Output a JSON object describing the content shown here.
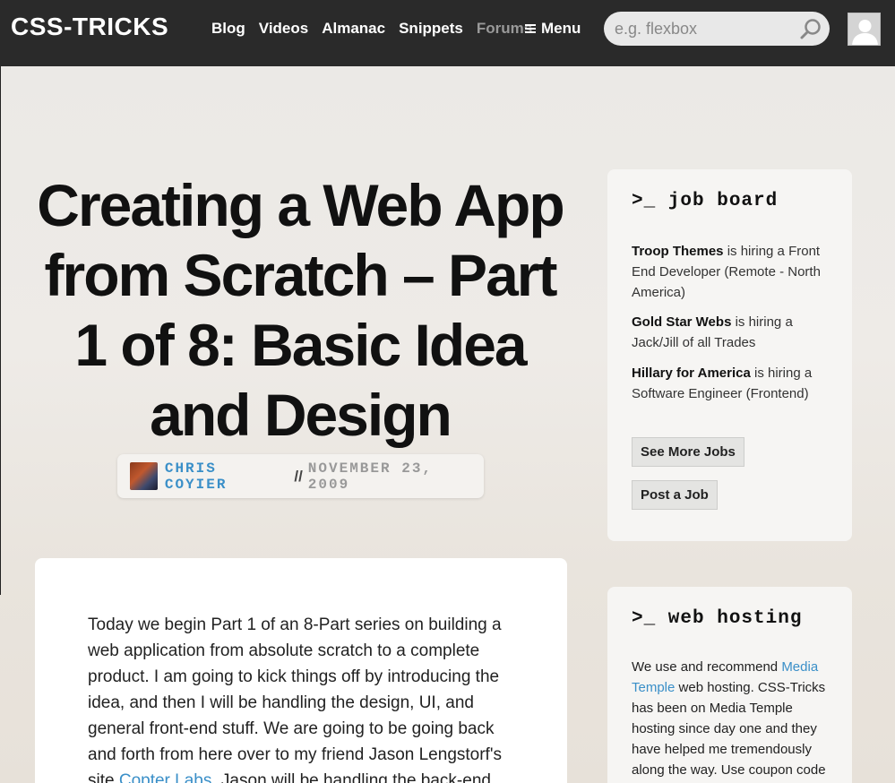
{
  "header": {
    "logo": "CSS-TRICKS",
    "nav": [
      "Blog",
      "Videos",
      "Almanac",
      "Snippets",
      "Forums"
    ],
    "menu_label": "Menu",
    "search_placeholder": "e.g. flexbox"
  },
  "post": {
    "title": "Creating a Web App from Scratch – Part 1 of 8: Basic Idea and Design",
    "author": "CHRIS COYIER",
    "separator": "//",
    "date": "NOVEMBER 23, 2009",
    "intro_before_link": "Today we begin Part 1 of an 8-Part series on building a web application from absolute scratch to a complete product. I am going to kick things off by introducing the idea, and then I will be handling the design, UI, and general front-end stuff. We are going to be going back and forth from here over to my friend Jason Lengstorf's site ",
    "intro_link": "Copter Labs",
    "intro_after_link": ". Jason will be handling the back-end"
  },
  "job_board": {
    "title": ">_ job board",
    "jobs": [
      {
        "company": "Troop Themes",
        "text": " is hiring a Front End Developer (Remote - North America)"
      },
      {
        "company": "Gold Star Webs",
        "text": " is hiring a Jack/Jill of all Trades"
      },
      {
        "company": "Hillary for America",
        "text": " is hiring a Software Engineer (Frontend)"
      }
    ],
    "see_more": "See More Jobs",
    "post_job": "Post a Job"
  },
  "web_hosting": {
    "title": ">_ web hosting",
    "text_before": "We use and recommend ",
    "link": "Media Temple",
    "text_after": " web hosting. CSS-Tricks has been on Media Temple hosting since day one and they have helped me tremendously along the way. Use coupon code"
  },
  "colors": {
    "accent": "#3a8fc8",
    "header_bg": "#2a2a2a"
  }
}
